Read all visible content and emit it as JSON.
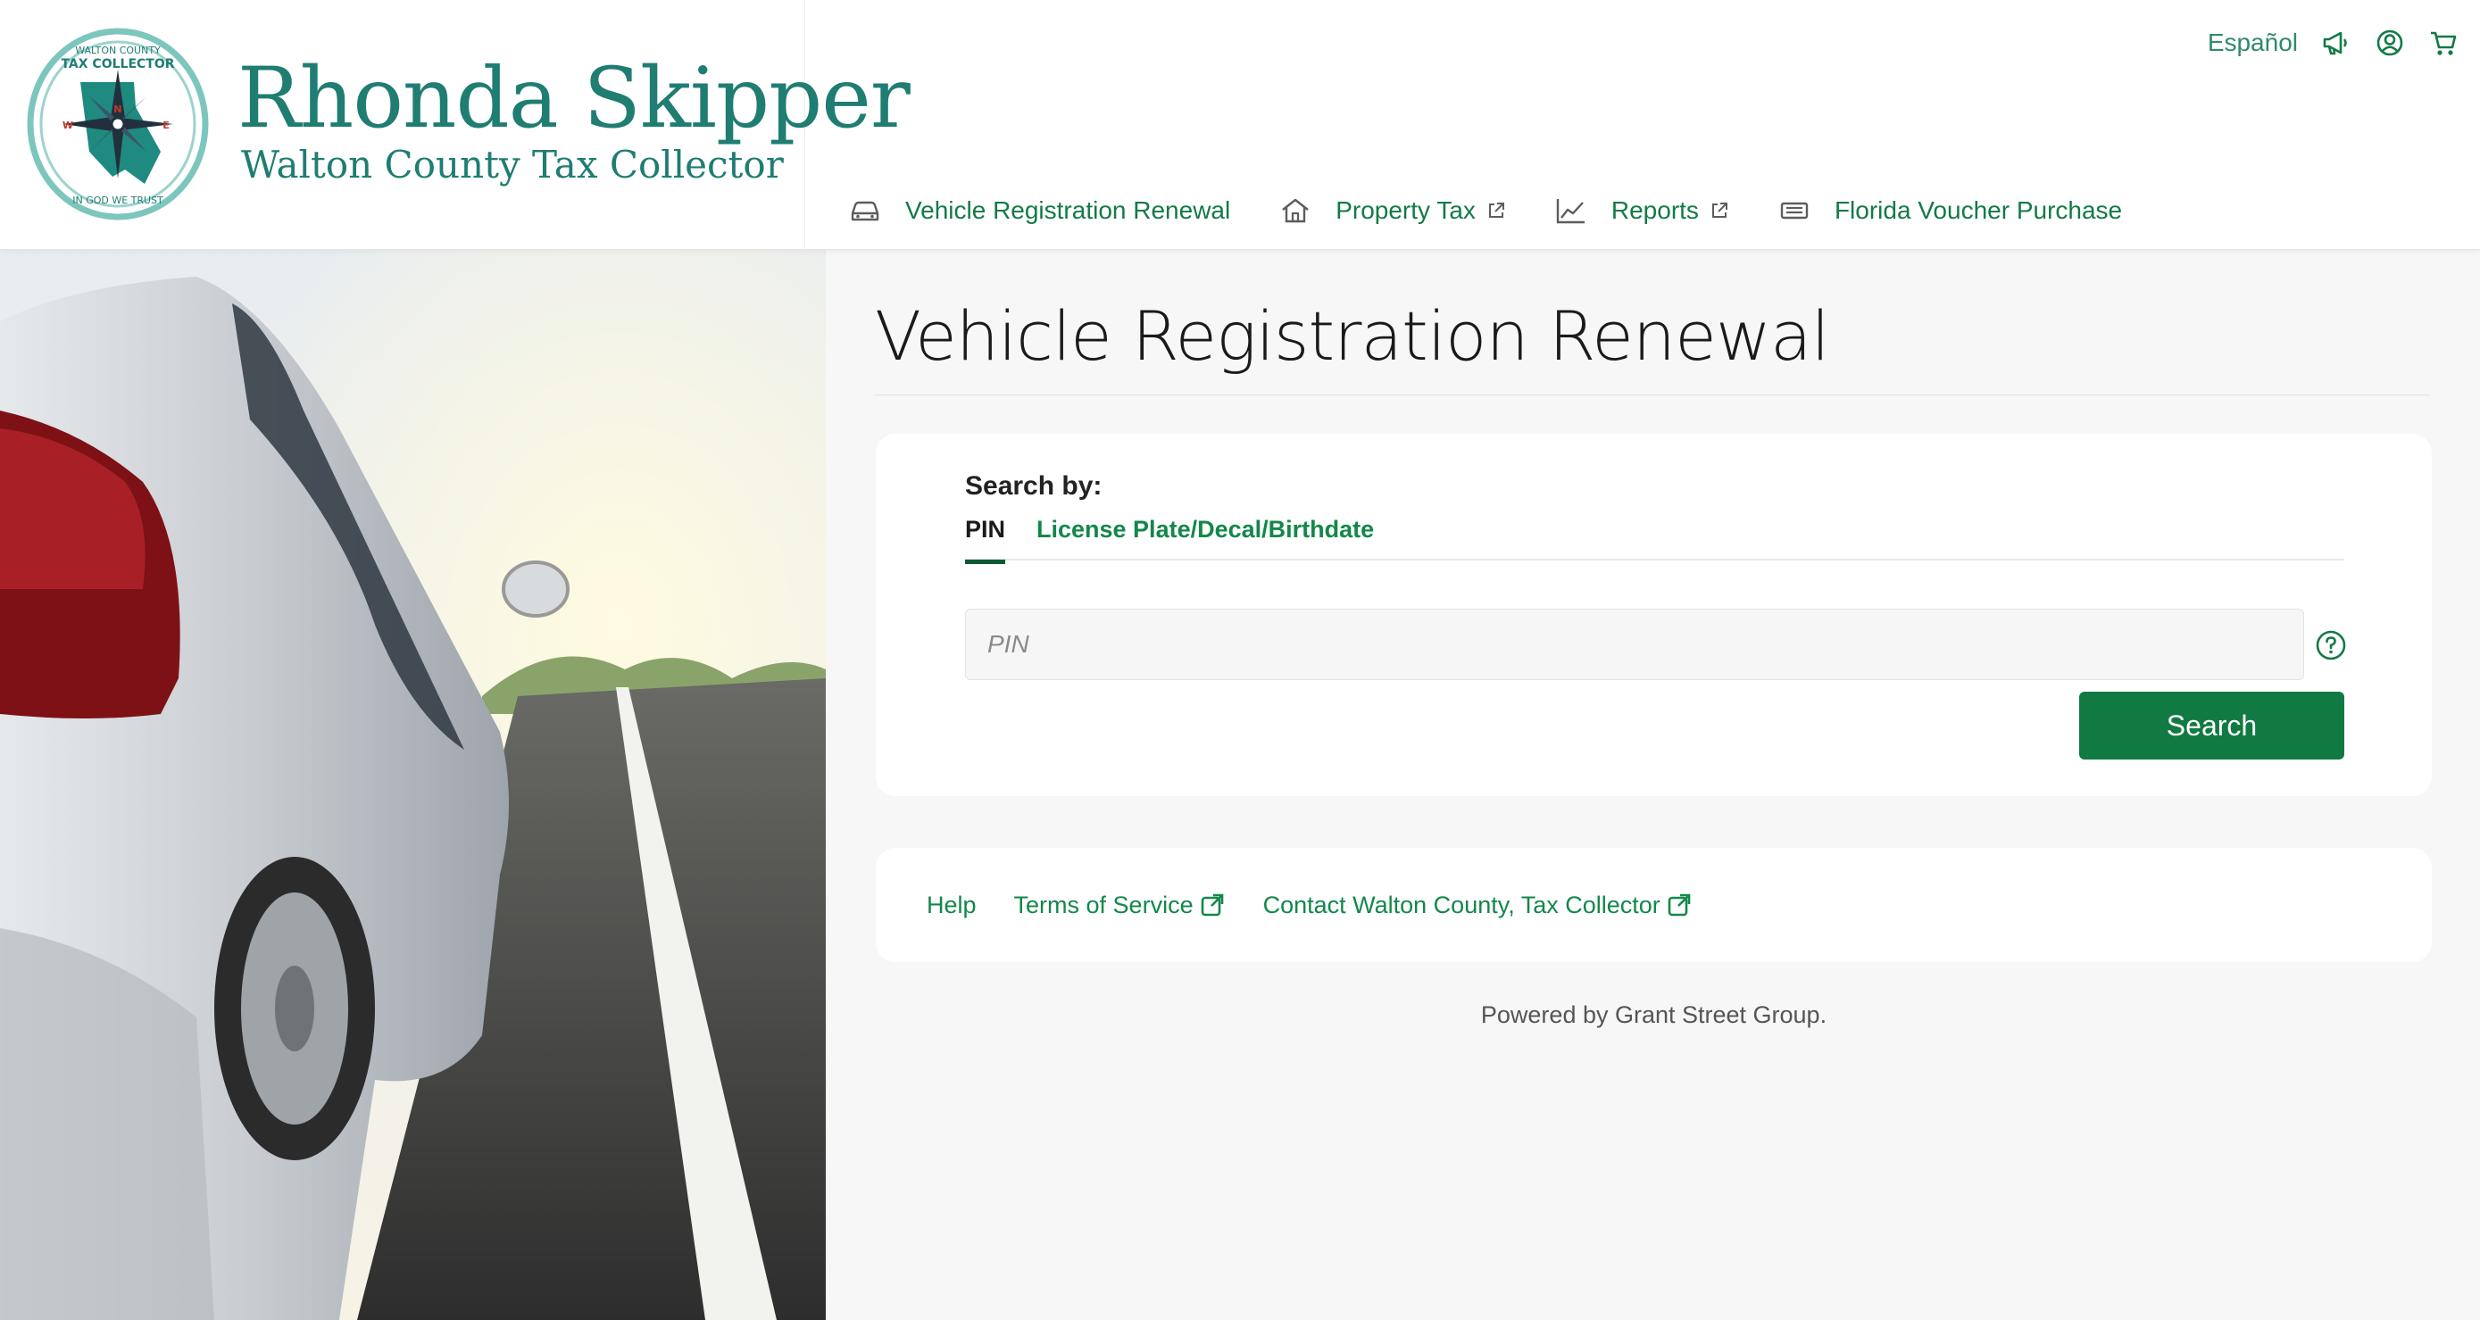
{
  "header": {
    "brand_name": "Rhonda Skipper",
    "brand_subtitle": "Walton County Tax Collector",
    "seal_text_top": "WALTON COUNTY",
    "seal_text_main": "TAX COLLECTOR",
    "seal_text_bottom": "IN GOD WE TRUST",
    "language_link": "Español",
    "utility_icons": [
      "megaphone-icon",
      "user-icon",
      "cart-icon"
    ]
  },
  "nav": {
    "items": [
      {
        "label": "Vehicle Registration Renewal",
        "icon": "car-icon",
        "external": false
      },
      {
        "label": "Property Tax",
        "icon": "house-icon",
        "external": true
      },
      {
        "label": "Reports",
        "icon": "chart-icon",
        "external": true
      },
      {
        "label": "Florida Voucher Purchase",
        "icon": "voucher-icon",
        "external": false
      }
    ]
  },
  "main": {
    "page_title": "Vehicle Registration Renewal",
    "search": {
      "search_by_label": "Search by:",
      "tabs": [
        {
          "label": "PIN",
          "active": true
        },
        {
          "label": "License Plate/Decal/Birthdate",
          "active": false
        }
      ],
      "input_placeholder": "PIN",
      "input_value": "",
      "button_label": "Search"
    }
  },
  "footer": {
    "links": [
      {
        "label": "Help",
        "external": false
      },
      {
        "label": "Terms of Service",
        "external": true
      },
      {
        "label": "Contact Walton County, Tax Collector",
        "external": true
      }
    ],
    "powered_by": "Powered by Grant Street Group."
  },
  "colors": {
    "brand_teal": "#1f7d72",
    "link_green": "#13874b",
    "button_green": "#107a42",
    "active_tab_underline": "#0b5a33",
    "page_background": "#f7f7f7"
  }
}
